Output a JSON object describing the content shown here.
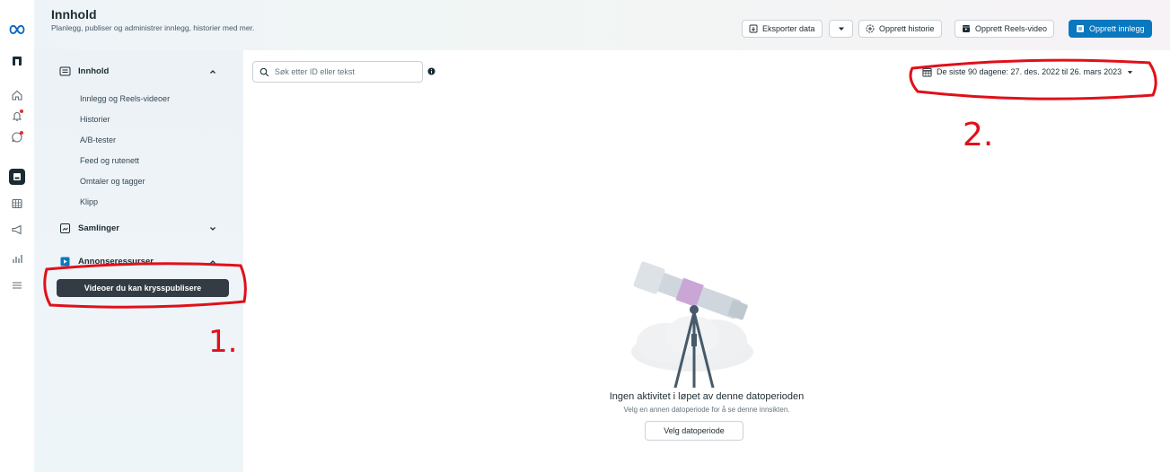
{
  "header": {
    "title": "Innhold",
    "subtitle": "Planlegg, publiser og administrer innlegg, historier med mer."
  },
  "toolbar": {
    "export_label": "Eksporter data",
    "create_story_label": "Opprett historie",
    "create_reels_label": "Opprett Reels-video",
    "create_post_label": "Opprett innlegg"
  },
  "sidebar": {
    "section_content": "Innhold",
    "items": [
      "Innlegg og Reels-videoer",
      "Historier",
      "A/B-tester",
      "Feed og rutenett",
      "Omtaler og tagger",
      "Klipp"
    ],
    "section_collections": "Samlinger",
    "section_ad_resources": "Annonseressurser",
    "crosspost_button": "Videoer du kan krysspublisere"
  },
  "search": {
    "placeholder": "Søk etter ID eller tekst"
  },
  "date_range": {
    "label": "De siste 90 dagene: 27. des. 2022 til 26. mars 2023"
  },
  "empty_state": {
    "title": "Ingen aktivitet i løpet av denne datoperioden",
    "subtitle": "Velg en annen datoperiode for å se denne innsikten.",
    "button": "Velg datoperiode"
  },
  "annotations": {
    "mark_1": "1.",
    "mark_2": "2."
  },
  "colors": {
    "primary": "#0a78be",
    "dark_button": "#333c44",
    "annotation": "#e0101a",
    "meta_logo": "#0a66c2"
  }
}
